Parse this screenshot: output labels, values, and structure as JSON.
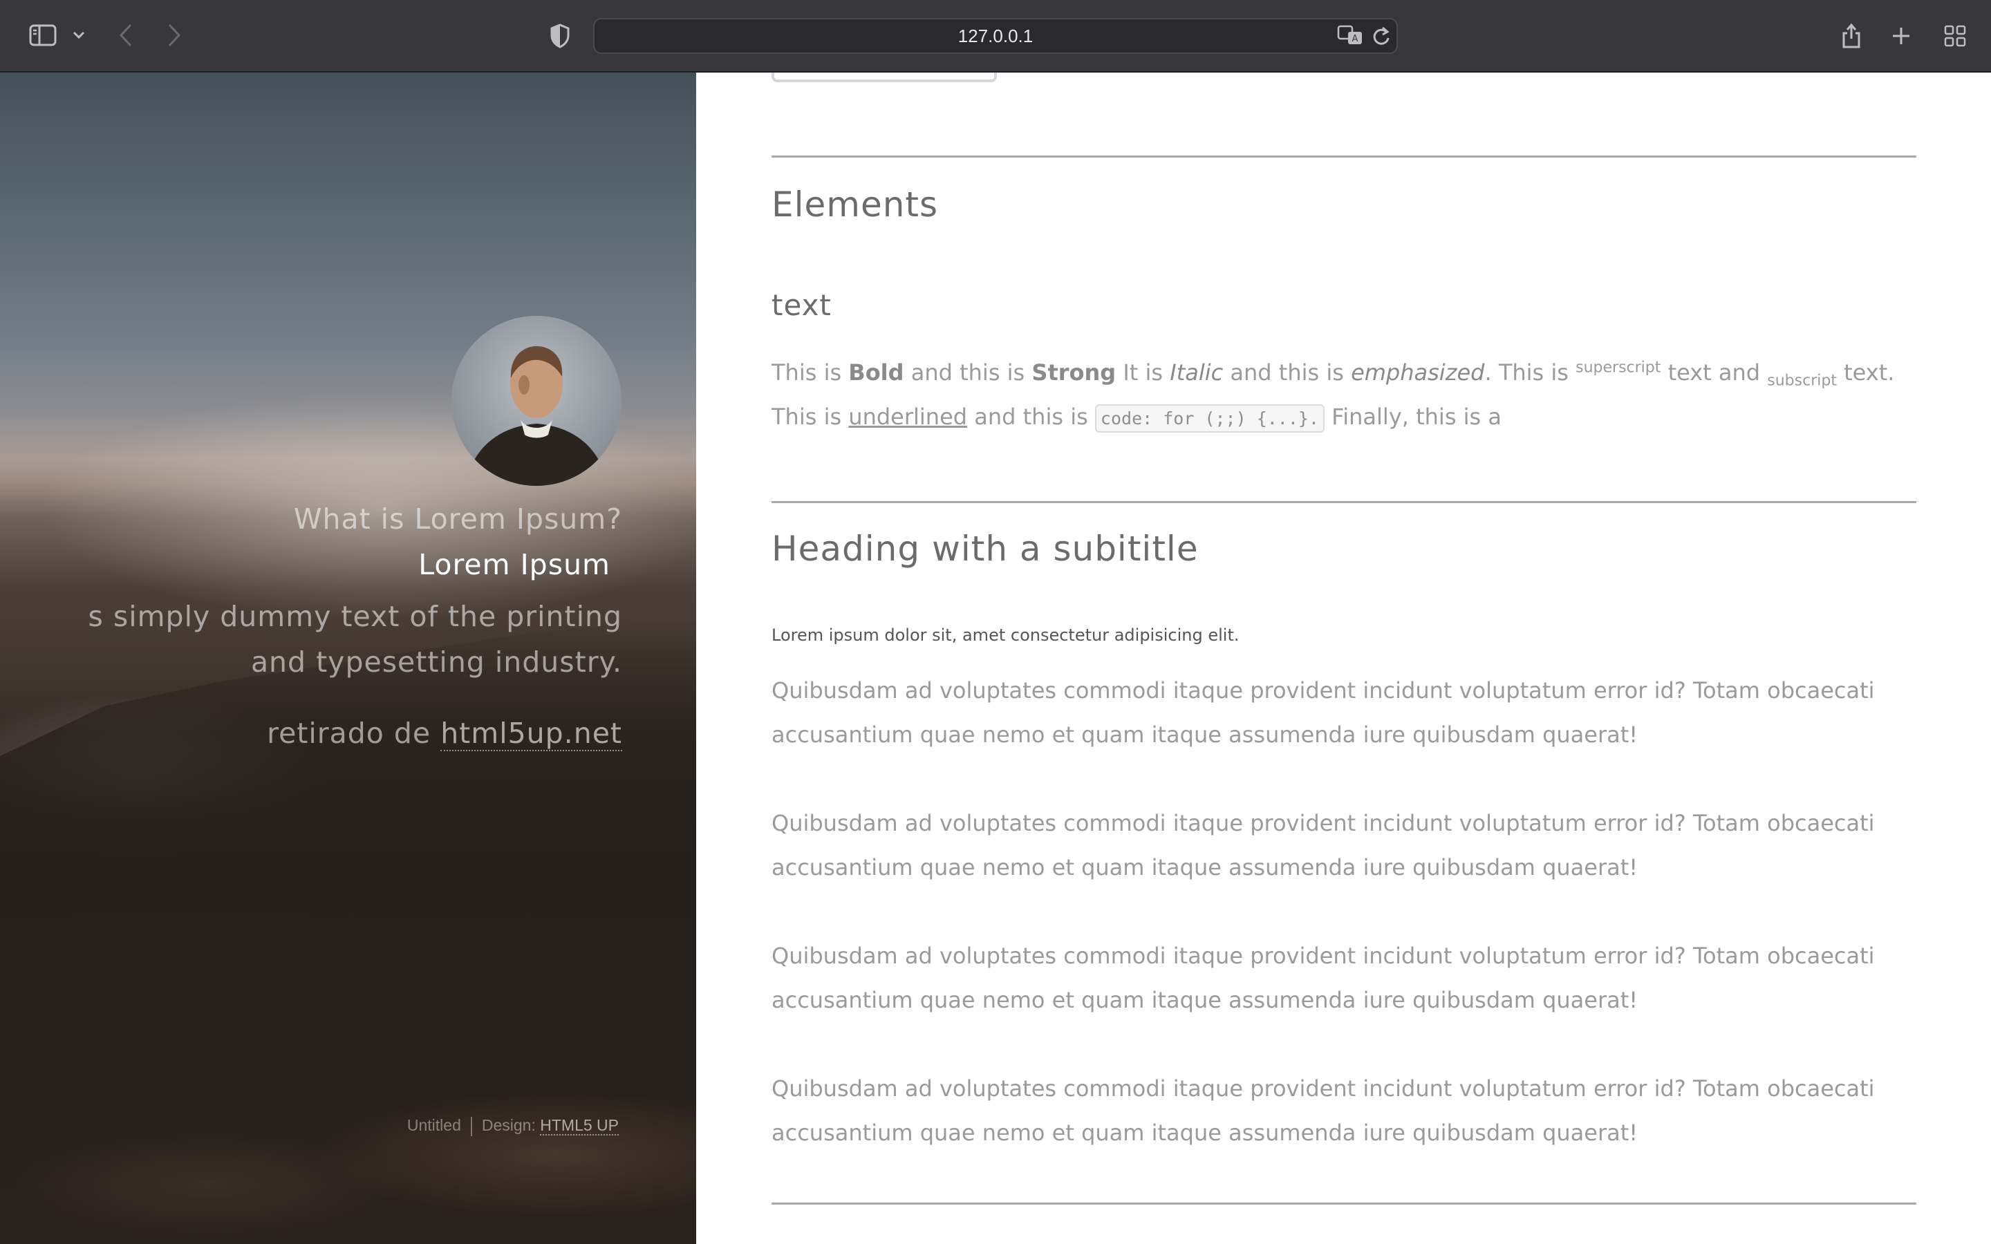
{
  "browser": {
    "url": "127.0.0.1"
  },
  "sidebar": {
    "question": "What is Lorem Ipsum?",
    "name": "Lorem Ipsum",
    "description_line1": "s simply dummy text of the printing",
    "description_line2": "and typesetting industry.",
    "credit_prefix": "retirado de ",
    "credit_link": "html5up.net",
    "footer_untitled": "Untitled",
    "footer_design_label": "Design: ",
    "footer_design_link": "HTML5 UP"
  },
  "main": {
    "elements_heading": "Elements",
    "text_heading": "text",
    "text_para": {
      "p1": "This is ",
      "bold": "Bold",
      "p2": " and this is ",
      "strong": "Strong",
      "p3": " It is ",
      "italic": "Italic",
      "p4": " and this is ",
      "emphasized": "emphasized",
      "p5": ". This is ",
      "superscript": "superscript",
      "p6": " text and ",
      "subscript": "subscript",
      "p7": " text.",
      "p8": "This is ",
      "underlined": "underlined",
      "p9": " and this is ",
      "code": "code: for (;;) {...}.",
      "p10": " Finally, this is a"
    },
    "subtitle_heading": "Heading with a subititle",
    "subtitle_line": "Lorem ipsum dolor sit, amet consectetur adipisicing elit.",
    "paragraphs": [
      "Quibusdam ad voluptates commodi itaque provident incidunt voluptatum error id? Totam obcaecati accusantium quae nemo et quam itaque assumenda iure quibusdam quaerat!",
      "Quibusdam ad voluptates commodi itaque provident incidunt voluptatum error id? Totam obcaecati accusantium quae nemo et quam itaque assumenda iure quibusdam quaerat!",
      "Quibusdam ad voluptates commodi itaque provident incidunt voluptatum error id? Totam obcaecati accusantium quae nemo et quam itaque assumenda iure quibusdam quaerat!",
      "Quibusdam ad voluptates commodi itaque provident incidunt voluptatum error id? Totam obcaecati accusantium quae nemo et quam itaque assumenda iure quibusdam quaerat!"
    ]
  },
  "icons": {
    "sidebar_toggle": "sidebar-icon",
    "chevron": "chevron-down-icon",
    "back": "back-arrow-icon",
    "forward": "forward-arrow-icon",
    "privacy": "shield-icon",
    "translate": "translate-icon",
    "reload": "reload-icon",
    "share": "share-icon",
    "new_tab": "plus-icon",
    "tab_overview": "grid-icon"
  }
}
